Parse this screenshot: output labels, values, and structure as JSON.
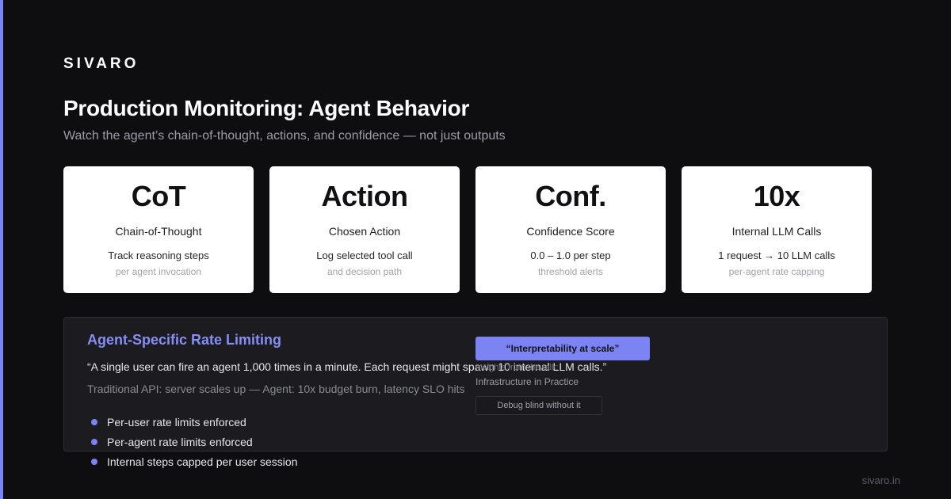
{
  "brand": {
    "logo": "SIVARO",
    "footer": "sivaro.in"
  },
  "header": {
    "title": "Production Monitoring: Agent Behavior",
    "subtitle": "Watch the agent’s chain-of-thought, actions, and confidence — not just outputs"
  },
  "cards": [
    {
      "value": "CoT",
      "label": "Chain-of-Thought",
      "desc": "Track reasoning steps",
      "sub": "per agent invocation"
    },
    {
      "value": "Action",
      "label": "Chosen Action",
      "desc": "Log selected tool call",
      "sub": "and decision path"
    },
    {
      "value": "Conf.",
      "label": "Confidence Score",
      "desc": "0.0 – 1.0 per step",
      "sub": "threshold alerts"
    },
    {
      "value": "10x",
      "label": "Internal LLM Calls",
      "desc": "1 request → 10 LLM calls",
      "sub": "per-agent rate capping"
    }
  ],
  "panel": {
    "title": "Agent-Specific Rate Limiting",
    "quote": "“A single user can fire an agent 1,000 times in a minute. Each request might spawn 10 internal LLM calls.”",
    "compare": "Traditional API: server scales up — Agent: 10x budget burn, latency SLO hits",
    "bullets": [
      "Per-user rate limits enforced",
      "Per-agent rate limits enforced",
      "Internal steps capped per user session"
    ],
    "badge": "“Interpretability at scale”",
    "source_line": "Insights from the talk:",
    "source_sub": "Infrastructure in Practice",
    "debug": "Debug blind without it"
  },
  "colors": {
    "accent": "#7c84f4",
    "background": "#0e0e10",
    "panel": "#1c1c20"
  }
}
